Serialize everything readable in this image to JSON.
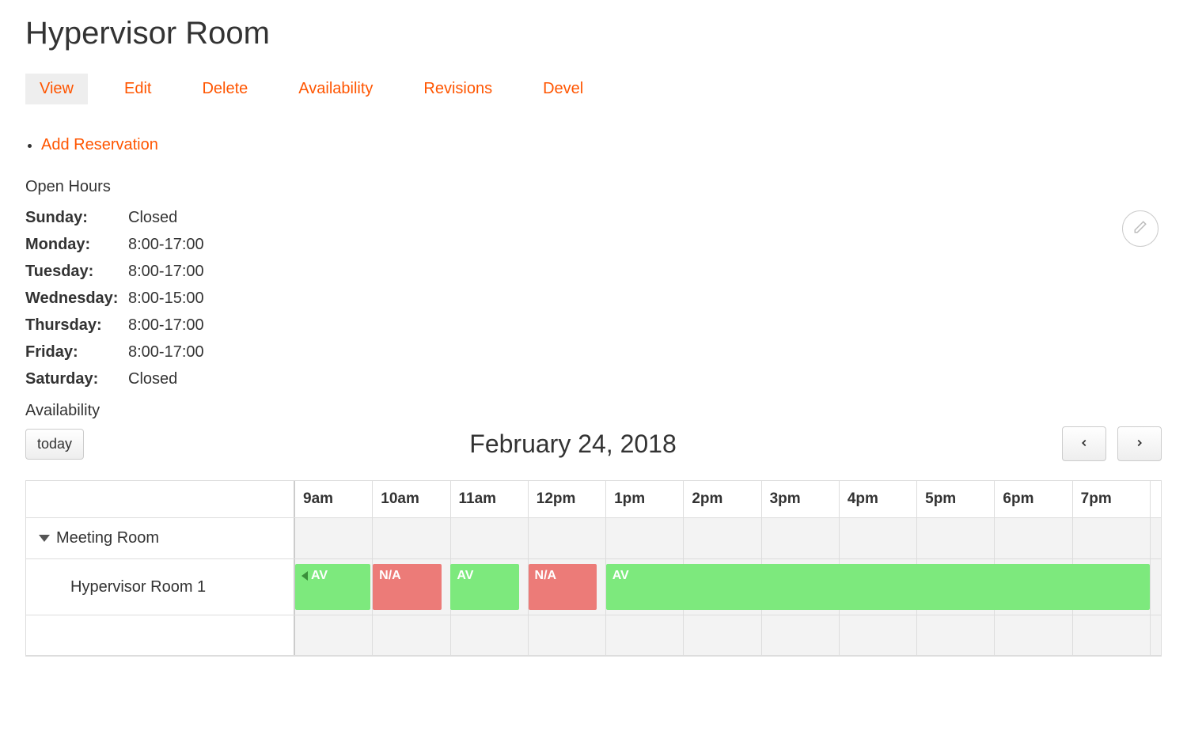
{
  "page": {
    "title": "Hypervisor Room"
  },
  "tabs": {
    "view": "View",
    "edit": "Edit",
    "delete": "Delete",
    "availability": "Availability",
    "revisions": "Revisions",
    "devel": "Devel"
  },
  "actions": {
    "add_reservation": "Add Reservation"
  },
  "open_hours": {
    "title": "Open Hours",
    "rows": [
      {
        "day": "Sunday:",
        "value": "Closed"
      },
      {
        "day": "Monday:",
        "value": "8:00-17:00"
      },
      {
        "day": "Tuesday:",
        "value": "8:00-17:00"
      },
      {
        "day": "Wednesday:",
        "value": "8:00-15:00"
      },
      {
        "day": "Thursday:",
        "value": "8:00-17:00"
      },
      {
        "day": "Friday:",
        "value": "8:00-17:00"
      },
      {
        "day": "Saturday:",
        "value": "Closed"
      }
    ]
  },
  "availability": {
    "label": "Availability",
    "today_btn": "today",
    "current_date": "February 24, 2018",
    "time_headers": [
      "9am",
      "10am",
      "11am",
      "12pm",
      "1pm",
      "2pm",
      "3pm",
      "4pm",
      "5pm",
      "6pm",
      "7pm"
    ],
    "group_label": "Meeting Room",
    "resource_label": "Hypervisor Room 1",
    "events": {
      "av1": "AV",
      "na1": "N/A",
      "av2": "AV",
      "na2": "N/A",
      "av3": "AV"
    }
  }
}
